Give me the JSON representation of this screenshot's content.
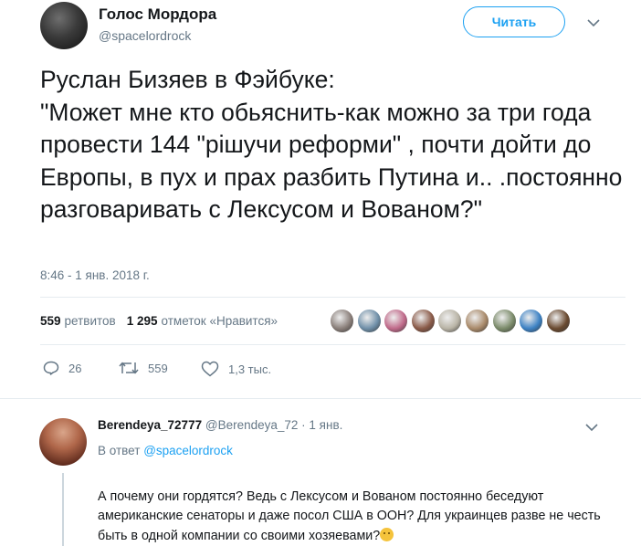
{
  "tweet": {
    "author_name": "Голос Мордора",
    "author_handle": "@spacelordrock",
    "follow_label": "Читать",
    "text": "Руслан Бизяев в Фэйбуке:\n\"Может мне кто обьяснить-как можно за три года провести 144 \"рішучи реформи\" , почти дойти до Европы, в пух и прах разбить Путина и.. .постоянно разговаривать с Лексусом и Вованом?\"",
    "timestamp": "8:46 - 1 янв. 2018 г.",
    "retweets_count": "559",
    "retweets_label": "ретвитов",
    "likes_count": "1 295",
    "likes_label": "отметок «Нравится»",
    "liker_colors": [
      "#8a7f7a",
      "#6f8fa8",
      "#c06a8a",
      "#8a5a48",
      "#b9b4a6",
      "#a98a6a",
      "#7b8b6a",
      "#3d82c4",
      "#6a4a30"
    ],
    "actions": {
      "replies": "26",
      "retweets": "559",
      "likes": "1,3 тыс."
    }
  },
  "reply": {
    "author_name": "Berendeya_72777",
    "author_handle": "@Berendeya_72",
    "separator": "·",
    "date": "1 янв.",
    "in_reply_prefix": "В ответ",
    "in_reply_handle": "@spacelordrock",
    "text": "А почему они гордятся? Ведь с Лексусом и Вованом постоянно беседуют американские сенаторы и даже посол США в ООН? Для украинцев разве не честь быть в одной компании со своими хозяевами?"
  },
  "colors": {
    "accent": "#1da1f2",
    "secondary_text": "#657786",
    "divider": "#e6ecf0"
  },
  "icons": [
    "chevron-down-icon",
    "reply-icon",
    "retweet-icon",
    "like-icon",
    "thinking-face-emoji"
  ]
}
